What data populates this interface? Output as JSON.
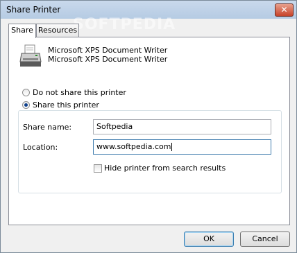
{
  "window": {
    "title": "Share Printer",
    "watermark": "SOFTPEDIA",
    "close_glyph": "✕"
  },
  "tabs": [
    {
      "label": "Share"
    },
    {
      "label": "Resources"
    }
  ],
  "printer": {
    "line1": "Microsoft XPS Document Writer",
    "line2": "Microsoft XPS Document Writer",
    "icon": "printer-icon"
  },
  "sharing": {
    "options": [
      {
        "label": "Do not share this printer",
        "checked": false
      },
      {
        "label": "Share this printer",
        "checked": true
      }
    ]
  },
  "fields": {
    "share_name_label": "Share name:",
    "share_name_value": "Softpedia",
    "location_label": "Location:",
    "location_value": "www.softpedia.com"
  },
  "hide_checkbox": {
    "label": "Hide printer from search results",
    "checked": false
  },
  "buttons": {
    "ok": "OK",
    "cancel": "Cancel"
  },
  "colors": {
    "title_bar": "#c9d9ec",
    "close_button": "#c7432a",
    "radio_dot": "#0d3f8b",
    "focus_border": "#3d7bad"
  }
}
